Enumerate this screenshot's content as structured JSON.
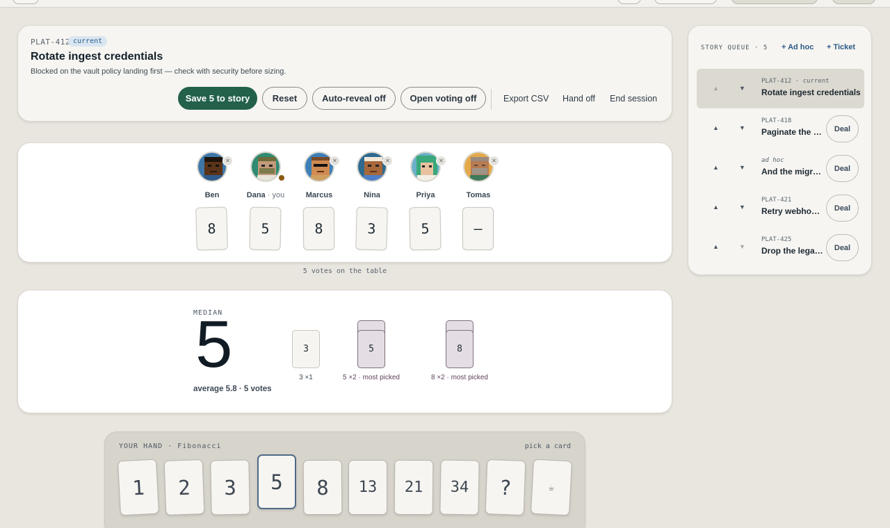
{
  "story": {
    "key": "PLAT-412",
    "status": "current",
    "title": "Rotate ingest credentials",
    "note": "Blocked on the vault policy landing first — check with security before sizing.",
    "buttons": {
      "save": "Save 5 to story",
      "reset": "Reset",
      "auto_reveal": "Auto-reveal off",
      "open_voting": "Open voting off"
    },
    "links": {
      "export": "Export CSV",
      "hand_off": "Hand off",
      "end": "End session"
    }
  },
  "players": [
    {
      "name": "Ben",
      "suffix": "",
      "vote": "8"
    },
    {
      "name": "Dana",
      "suffix": "· you",
      "vote": "5"
    },
    {
      "name": "Marcus",
      "suffix": "",
      "vote": "8"
    },
    {
      "name": "Nina",
      "suffix": "",
      "vote": "3"
    },
    {
      "name": "Priya",
      "suffix": "",
      "vote": "5"
    },
    {
      "name": "Tomas",
      "suffix": "",
      "vote": "—"
    }
  ],
  "votes_caption": "5 votes on the table",
  "results": {
    "median_label": "MEDIAN",
    "median": "5",
    "summary": "average 5.8 · 5 votes",
    "distribution": [
      {
        "value": "3",
        "label": "3 ×1",
        "count": 1,
        "most": false
      },
      {
        "value": "5",
        "label": "5 ×2 · most picked",
        "count": 2,
        "most": true
      },
      {
        "value": "8",
        "label": "8 ×2 · most picked",
        "count": 2,
        "most": true
      }
    ]
  },
  "queue": {
    "title": "STORY QUEUE · 5",
    "add_adhoc": "+ Ad hoc",
    "add_ticket": "+ Ticket",
    "deal_label": "Deal",
    "items": [
      {
        "key": "PLAT-412 · current",
        "name": "Rotate ingest credentials",
        "active": true
      },
      {
        "key": "PLAT-418",
        "name": "Paginate the a…",
        "active": false
      },
      {
        "key": "ad hoc",
        "name": "And the migra…",
        "active": false
      },
      {
        "key": "PLAT-421",
        "name": "Retry webhoo…",
        "active": false
      },
      {
        "key": "PLAT-425",
        "name": "Drop the lega…",
        "active": false
      }
    ]
  },
  "hand": {
    "title": "YOUR HAND · Fibonacci",
    "hint": "pick a card",
    "selected": "5",
    "cards": [
      "1",
      "2",
      "3",
      "5",
      "8",
      "13",
      "21",
      "34",
      "?",
      "☕"
    ]
  },
  "colors": {
    "primary": "#23614b",
    "background": "#e8e6df",
    "accent": "#2d5a86",
    "pick": "#e5dde4"
  }
}
